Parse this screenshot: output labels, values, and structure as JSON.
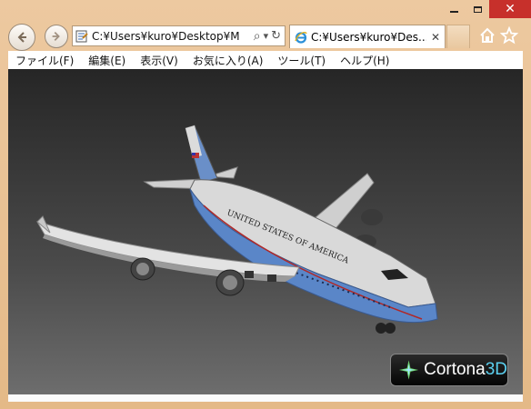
{
  "window": {
    "minimize_label": "",
    "maximize_label": "",
    "close_label": "✕"
  },
  "address_bar": {
    "url": "C:¥Users¥kuro¥Desktop¥M",
    "search_glyph": "⌕",
    "dropdown_glyph": "▾",
    "refresh_glyph": "↻"
  },
  "tab": {
    "title": "C:¥Users¥kuro¥Des...",
    "close_glyph": "✕"
  },
  "menu": {
    "items": [
      "ファイル(F)",
      "編集(E)",
      "表示(V)",
      "お気に入り(A)",
      "ツール(T)",
      "ヘルプ(H)"
    ]
  },
  "viewer": {
    "logo_text": "Cortona",
    "logo_suffix": "3D",
    "fuselage_text": "UNITED STATES OF AMERICA"
  },
  "colors": {
    "frame": "#e9c08f",
    "close": "#c7302b",
    "fuselage_blue": "#5a86c8",
    "fuselage_white": "#d9d9d9",
    "logo_accent": "#5bd0f0"
  },
  "icons": [
    "back-icon",
    "forward-icon",
    "page-icon",
    "search-icon",
    "dropdown-icon",
    "refresh-icon",
    "ie-icon",
    "close-icon",
    "home-icon",
    "star-icon",
    "cortona-icon"
  ]
}
